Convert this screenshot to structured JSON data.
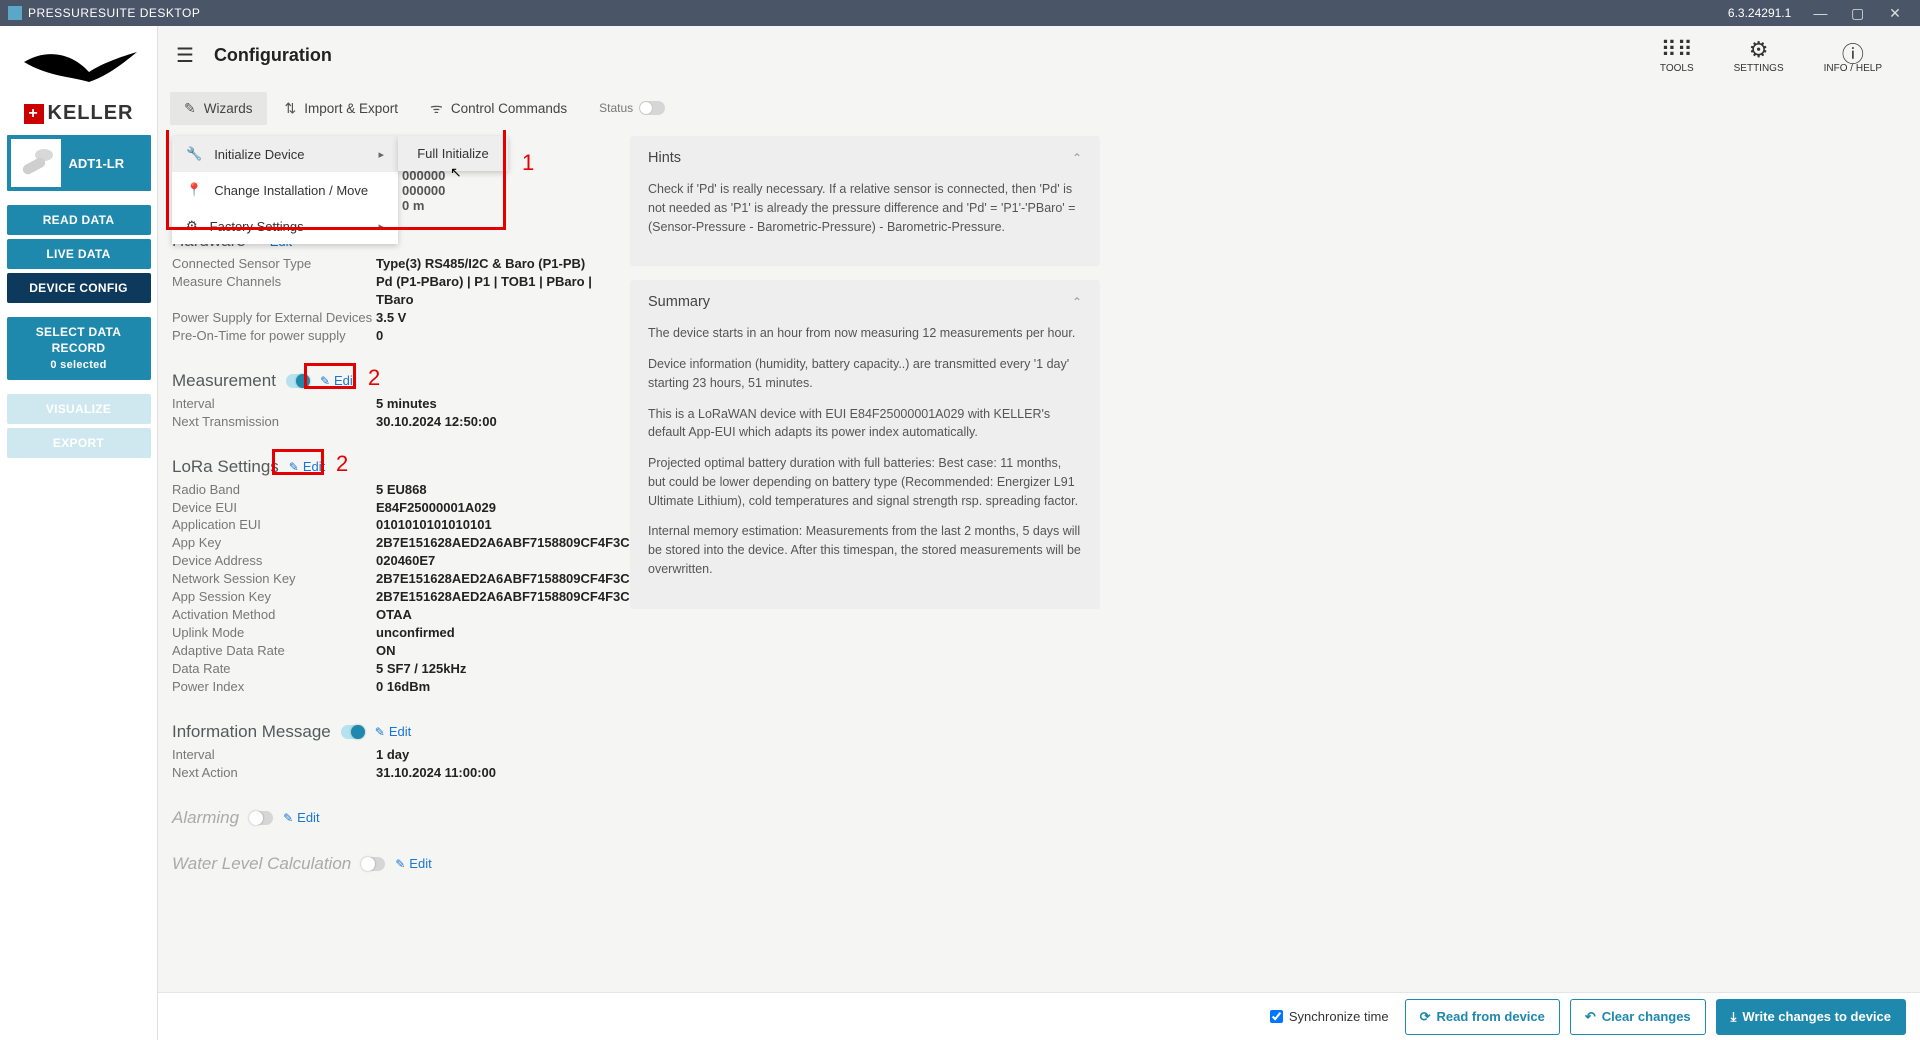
{
  "titlebar": {
    "title": "PRESSURESUITE DESKTOP",
    "version": "6.3.24291.1"
  },
  "brand": {
    "name": "KELLER"
  },
  "device": {
    "model": "ADT1-LR"
  },
  "side": {
    "read": "READ DATA",
    "live": "LIVE DATA",
    "config": "DEVICE CONFIG",
    "select": "SELECT DATA RECORD",
    "selected": "0 selected",
    "visualize": "VISUALIZE",
    "export": "EXPORT"
  },
  "header": {
    "page": "Configuration",
    "tools": "TOOLS",
    "settings": "SETTINGS",
    "info": "INFO / HELP"
  },
  "tabs": {
    "wizards": "Wizards",
    "import": "Import & Export",
    "control": "Control Commands",
    "status": "Status"
  },
  "wizard_menu": {
    "initialize": "Initialize Device",
    "change": "Change Installation / Move",
    "factory": "Factory Settings",
    "full_init": "Full Initialize"
  },
  "peek": {
    "l1": "000000",
    "l2": "000000",
    "l3": "0 m"
  },
  "annot": {
    "one": "1",
    "two": "2"
  },
  "sections": {
    "hardware": {
      "title": "Hardware",
      "edit": "Edit",
      "rows": {
        "sensorType": {
          "k": "Connected Sensor Type",
          "v": "Type(3) RS485/I2C & Baro (P1-PB)"
        },
        "channels": {
          "k": "Measure Channels",
          "v": "Pd (P1-PBaro) | P1 | TOB1 | PBaro | TBaro"
        },
        "power": {
          "k": "Power Supply for External Devices",
          "v": "3.5 V"
        },
        "preon": {
          "k": "Pre-On-Time for power supply",
          "v": "0"
        }
      }
    },
    "measurement": {
      "title": "Measurement",
      "edit": "Edit",
      "rows": {
        "interval": {
          "k": "Interval",
          "v": "5 minutes"
        },
        "next": {
          "k": "Next Transmission",
          "v": "30.10.2024 12:50:00"
        }
      }
    },
    "lora": {
      "title": "LoRa Settings",
      "edit": "Edit",
      "rows": {
        "band": {
          "k": "Radio Band",
          "v": "5 EU868"
        },
        "eui": {
          "k": "Device EUI",
          "v": "E84F25000001A029"
        },
        "appeui": {
          "k": "Application EUI",
          "v": "0101010101010101"
        },
        "appkey": {
          "k": "App Key",
          "v": "2B7E151628AED2A6ABF7158809CF4F3C"
        },
        "addr": {
          "k": "Device Address",
          "v": "020460E7"
        },
        "nsk": {
          "k": "Network Session Key",
          "v": "2B7E151628AED2A6ABF7158809CF4F3C"
        },
        "ask": {
          "k": "App Session Key",
          "v": "2B7E151628AED2A6ABF7158809CF4F3C"
        },
        "act": {
          "k": "Activation Method",
          "v": "OTAA"
        },
        "uplink": {
          "k": "Uplink Mode",
          "v": "unconfirmed"
        },
        "adr": {
          "k": "Adaptive Data Rate",
          "v": "ON"
        },
        "rate": {
          "k": "Data Rate",
          "v": "5 SF7 / 125kHz"
        },
        "pidx": {
          "k": "Power Index",
          "v": "0 16dBm"
        }
      }
    },
    "info_msg": {
      "title": "Information Message",
      "edit": "Edit",
      "rows": {
        "interval": {
          "k": "Interval",
          "v": "1 day"
        },
        "next": {
          "k": "Next Action",
          "v": "31.10.2024 11:00:00"
        }
      }
    },
    "alarming": {
      "title": "Alarming",
      "edit": "Edit"
    },
    "water": {
      "title": "Water Level Calculation",
      "edit": "Edit"
    }
  },
  "hints": {
    "title": "Hints",
    "text": "Check if 'Pd' is really necessary. If a relative sensor is connected, then 'Pd' is not needed as 'P1' is already the pressure difference and 'Pd' = 'P1'-'PBaro' = (Sensor-Pressure - Barometric-Pressure) - Barometric-Pressure."
  },
  "summary": {
    "title": "Summary",
    "p1": "The device starts in an hour from now measuring 12 measurements per hour.",
    "p2": "Device information (humidity, battery capacity..) are transmitted every '1 day' starting 23 hours, 51 minutes.",
    "p3": "This is a LoRaWAN device with EUI E84F25000001A029 with KELLER's default App-EUI which adapts its power index automatically.",
    "p4": "Projected optimal battery duration with full batteries: Best case: 11 months, but could be lower depending on battery type (Recommended: Energizer L91 Ultimate Lithium), cold temperatures and signal strength rsp. spreading factor.",
    "p5": "Internal memory estimation: Measurements from the last 2 months, 5 days will be stored into the device. After this timespan, the stored measurements will be overwritten."
  },
  "bottom": {
    "sync": "Synchronize time",
    "read": "Read from device",
    "clear": "Clear changes",
    "write": "Write changes to device"
  }
}
